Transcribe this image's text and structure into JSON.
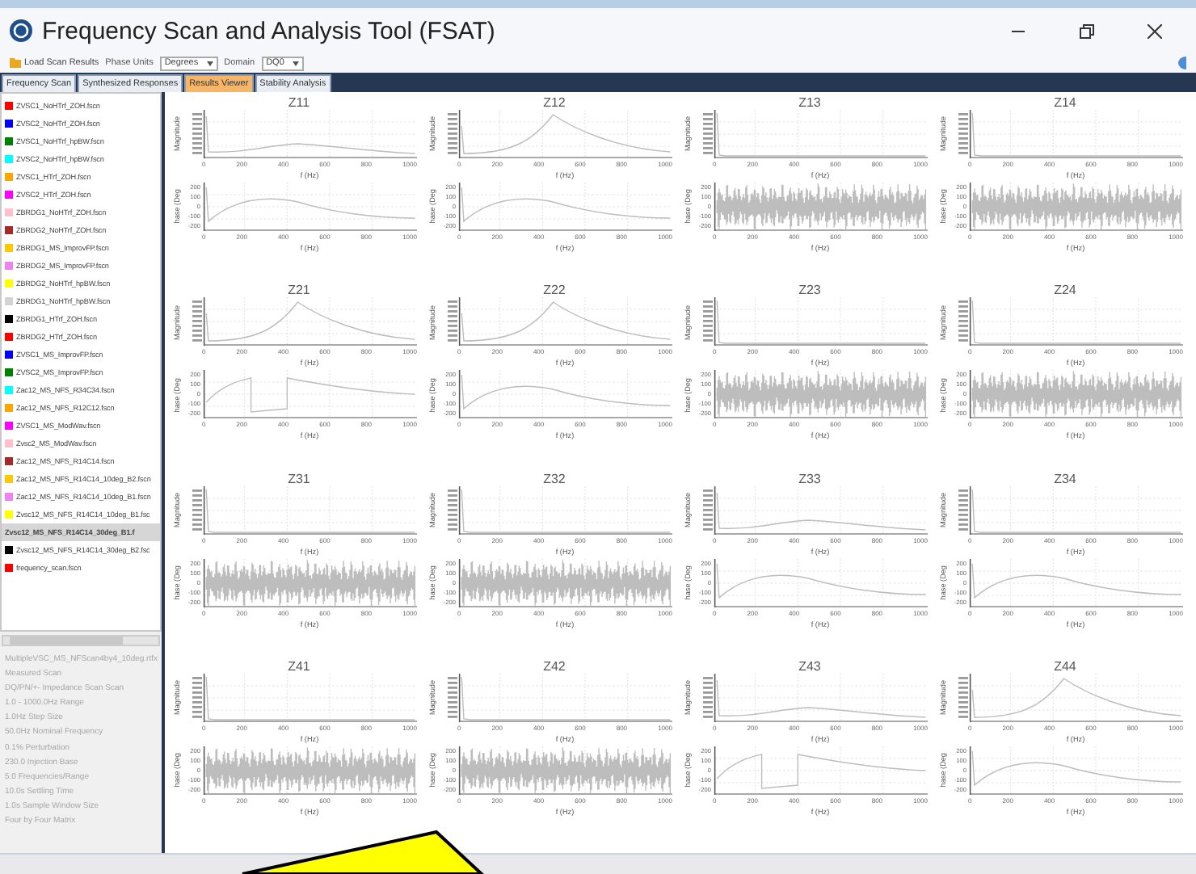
{
  "window": {
    "title": "Frequency Scan and Analysis Tool (FSAT)"
  },
  "toolbar": {
    "load_button": "Load Scan Results",
    "phase_units": {
      "label": "Phase Units",
      "value": "Degrees"
    },
    "domain": {
      "label": "Domain",
      "value": "DQ0"
    }
  },
  "tabs": [
    {
      "label": "Frequency Scan",
      "selected": false
    },
    {
      "label": "Synthesized Responses",
      "selected": false
    },
    {
      "label": "Results Viewer",
      "selected": true
    },
    {
      "label": "Stability Analysis",
      "selected": false
    }
  ],
  "scan_files": [
    {
      "name": "ZVSC1_NoHTrf_ZOH.fscn",
      "color": "#ff0000",
      "selected": false
    },
    {
      "name": "ZVSC2_NoHTrf_ZOH.fscn",
      "color": "#0000ff",
      "selected": false
    },
    {
      "name": "ZVSC1_NoHTrf_hpBW.fscn",
      "color": "#008000",
      "selected": false
    },
    {
      "name": "ZVSC2_NoHTrf_hpBW.fscn",
      "color": "#00ffff",
      "selected": false
    },
    {
      "name": "ZVSC1_HTrf_ZOH.fscn",
      "color": "#ffa500",
      "selected": false
    },
    {
      "name": "ZVSC2_HTrf_ZOH.fscn",
      "color": "#ff00ff",
      "selected": false
    },
    {
      "name": "ZBRDG1_NoHTrf_ZOH.fscn",
      "color": "#ffc0cb",
      "selected": false
    },
    {
      "name": "ZBRDG2_NoHTrf_ZOH.fscn",
      "color": "#a52a2a",
      "selected": false
    },
    {
      "name": "ZBRDG1_MS_ImprovFP.fscn",
      "color": "#ffc800",
      "selected": false
    },
    {
      "name": "ZBRDG2_MS_ImprovFP.fscn",
      "color": "#ee82ee",
      "selected": false
    },
    {
      "name": "ZBRDG2_NoHTrf_hpBW.fscn",
      "color": "#ffff00",
      "selected": false
    },
    {
      "name": "ZBRDG1_NoHTrf_hpBW.fscn",
      "color": "#d3d3d3",
      "selected": false
    },
    {
      "name": "ZBRDG1_HTrf_ZOH.fscn",
      "color": "#000000",
      "selected": false
    },
    {
      "name": "ZBRDG2_HTrf_ZOH.fscn",
      "color": "#ff0000",
      "selected": false
    },
    {
      "name": "ZVSC1_MS_ImprovFP.fscn",
      "color": "#0000ff",
      "selected": false
    },
    {
      "name": "ZVSC2_MS_ImprovFP.fscn",
      "color": "#008000",
      "selected": false
    },
    {
      "name": "Zac12_MS_NFS_R34C34.fscn",
      "color": "#00ffff",
      "selected": false
    },
    {
      "name": "Zac12_MS_NFS_R12C12.fscn",
      "color": "#ffa500",
      "selected": false
    },
    {
      "name": "ZVSC1_MS_ModWav.fscn",
      "color": "#ff00ff",
      "selected": false
    },
    {
      "name": "Zvsc2_MS_ModWav.fscn",
      "color": "#ffc0cb",
      "selected": false
    },
    {
      "name": "Zac12_MS_NFS_R14C14.fscn",
      "color": "#a52a2a",
      "selected": false
    },
    {
      "name": "Zac12_MS_NFS_R14C14_10deg_B2.fscn",
      "color": "#ffc800",
      "selected": false
    },
    {
      "name": "Zac12_MS_NFS_R14C14_10deg_B1.fscn",
      "color": "#ee82ee",
      "selected": false
    },
    {
      "name": "Zvsc12_MS_NFS_R14C14_10deg_B1.fsc",
      "color": "#ffff00",
      "selected": false
    },
    {
      "name": "Zvsc12_MS_NFS_R14C14_30deg_B1.f",
      "selected": true
    },
    {
      "name": "Zvsc12_MS_NFS_R14C14_30deg_B2.fsc",
      "color": "#000000",
      "selected": false
    },
    {
      "name": "frequency_scan.fscn",
      "color": "#ff0000",
      "selected": false
    }
  ],
  "scan_info": [
    "MultipleVSC_MS_NFScan4by4_10deg.rtfx",
    "Measured Scan",
    "DQ/PN/+- Impedance Scan Scan",
    "1.0 - 1000.0Hz Range",
    "1.0Hz Step Size",
    "50.0Hz Nominal Frequency",
    "0.1% Perturbation",
    "230.0 Injection Base",
    "5.0 Frequencies/Range",
    "10.0s Settling Time",
    "1.0s Sample Window Size",
    "Four by Four Matrix"
  ],
  "panels": [
    {
      "title": "Z11",
      "plots": [
        {
          "kind": "magnitude",
          "ylabel": "Magnitude",
          "xticks": [
            "0",
            "200",
            "400",
            "600",
            "800",
            "1000"
          ],
          "xlabel": "f (Hz)"
        },
        {
          "kind": "phase",
          "ylabel": "hase (Deg",
          "yticks": [
            "200",
            "100",
            "0",
            "-100",
            "-200"
          ],
          "xticks": [
            "0",
            "200",
            "400",
            "600",
            "800",
            "1000"
          ],
          "xlabel": "f (Hz)"
        }
      ]
    },
    {
      "title": "Z12",
      "plots": [
        {
          "kind": "magnitude",
          "ylabel": "Magnitude",
          "xticks": [
            "0",
            "200",
            "400",
            "600",
            "800",
            "1000"
          ],
          "xlabel": "f (Hz)"
        },
        {
          "kind": "phase",
          "ylabel": "hase (Deg",
          "yticks": [
            "200",
            "100",
            "0",
            "-100",
            "-200"
          ],
          "xticks": [
            "0",
            "200",
            "400",
            "600",
            "800",
            "1000"
          ],
          "xlabel": "f (Hz)"
        }
      ]
    },
    {
      "title": "Z13",
      "plots": [
        {
          "kind": "magnitude",
          "ylabel": "Magnitude",
          "xticks": [
            "0",
            "200",
            "400",
            "600",
            "800",
            "1000"
          ],
          "xlabel": "f (Hz)"
        },
        {
          "kind": "phase",
          "ylabel": "hase (Deg",
          "yticks": [
            "200",
            "100",
            "0",
            "-100",
            "-200"
          ],
          "xticks": [
            "0",
            "200",
            "400",
            "600",
            "800",
            "1000"
          ],
          "xlabel": "f (Hz)"
        }
      ]
    },
    {
      "title": "Z14",
      "plots": [
        {
          "kind": "magnitude",
          "ylabel": "Magnitude",
          "xticks": [
            "0",
            "200",
            "400",
            "600",
            "800",
            "1000"
          ],
          "xlabel": "f (Hz)"
        },
        {
          "kind": "phase",
          "ylabel": "hase (Deg",
          "yticks": [
            "200",
            "100",
            "0",
            "-100",
            "-200"
          ],
          "xticks": [
            "0",
            "200",
            "400",
            "600",
            "800",
            "1000"
          ],
          "xlabel": "f (Hz)"
        }
      ]
    },
    {
      "title": "Z21",
      "plots": [
        {
          "kind": "magnitude",
          "ylabel": "Magnitude",
          "xticks": [
            "0",
            "200",
            "400",
            "600",
            "800",
            "1000"
          ],
          "xlabel": "f (Hz)"
        },
        {
          "kind": "phase",
          "ylabel": "hase (Deg",
          "yticks": [
            "200",
            "100",
            "0",
            "-100",
            "-200"
          ],
          "xticks": [
            "0",
            "200",
            "400",
            "600",
            "800",
            "1000"
          ],
          "xlabel": "f (Hz)"
        }
      ]
    },
    {
      "title": "Z22",
      "plots": [
        {
          "kind": "magnitude",
          "ylabel": "Magnitude",
          "xticks": [
            "0",
            "200",
            "400",
            "600",
            "800",
            "1000"
          ],
          "xlabel": "f (Hz)"
        },
        {
          "kind": "phase",
          "ylabel": "hase (Deg",
          "yticks": [
            "200",
            "100",
            "0",
            "-100",
            "-200"
          ],
          "xticks": [
            "0",
            "200",
            "400",
            "600",
            "800",
            "1000"
          ],
          "xlabel": "f (Hz)"
        }
      ]
    },
    {
      "title": "Z23",
      "plots": [
        {
          "kind": "magnitude",
          "ylabel": "Magnitude",
          "xticks": [
            "0",
            "200",
            "400",
            "600",
            "800",
            "1000"
          ],
          "xlabel": "f (Hz)"
        },
        {
          "kind": "phase",
          "ylabel": "hase (Deg",
          "yticks": [
            "200",
            "100",
            "0",
            "-100",
            "-200"
          ],
          "xticks": [
            "0",
            "200",
            "400",
            "600",
            "800",
            "1000"
          ],
          "xlabel": "f (Hz)"
        }
      ]
    },
    {
      "title": "Z24",
      "plots": [
        {
          "kind": "magnitude",
          "ylabel": "Magnitude",
          "xticks": [
            "0",
            "200",
            "400",
            "600",
            "800",
            "1000"
          ],
          "xlabel": "f (Hz)"
        },
        {
          "kind": "phase",
          "ylabel": "hase (Deg",
          "yticks": [
            "200",
            "100",
            "0",
            "-100",
            "-200"
          ],
          "xticks": [
            "0",
            "200",
            "400",
            "600",
            "800",
            "1000"
          ],
          "xlabel": "f (Hz)"
        }
      ]
    },
    {
      "title": "Z31",
      "plots": [
        {
          "kind": "magnitude",
          "ylabel": "Magnitude",
          "xticks": [
            "0",
            "200",
            "400",
            "600",
            "800",
            "1000"
          ],
          "xlabel": "f (Hz)"
        },
        {
          "kind": "phase",
          "ylabel": "hase (Deg",
          "yticks": [
            "200",
            "100",
            "0",
            "-100",
            "-200"
          ],
          "xticks": [
            "0",
            "200",
            "400",
            "600",
            "800",
            "1000"
          ],
          "xlabel": "f (Hz)"
        }
      ]
    },
    {
      "title": "Z32",
      "plots": [
        {
          "kind": "magnitude",
          "ylabel": "Magnitude",
          "xticks": [
            "0",
            "200",
            "400",
            "600",
            "800",
            "1000"
          ],
          "xlabel": "f (Hz)"
        },
        {
          "kind": "phase",
          "ylabel": "hase (Deg",
          "yticks": [
            "200",
            "100",
            "0",
            "-100",
            "-200"
          ],
          "xticks": [
            "0",
            "200",
            "400",
            "600",
            "800",
            "1000"
          ],
          "xlabel": "f (Hz)"
        }
      ]
    },
    {
      "title": "Z33",
      "plots": [
        {
          "kind": "magnitude",
          "ylabel": "Magnitude",
          "xticks": [
            "0",
            "200",
            "400",
            "600",
            "800",
            "1000"
          ],
          "xlabel": "f (Hz)"
        },
        {
          "kind": "phase",
          "ylabel": "hase (Deg",
          "yticks": [
            "200",
            "100",
            "0",
            "-100",
            "-200"
          ],
          "xticks": [
            "0",
            "200",
            "400",
            "600",
            "800",
            "1000"
          ],
          "xlabel": "f (Hz)"
        }
      ]
    },
    {
      "title": "Z34",
      "plots": [
        {
          "kind": "magnitude",
          "ylabel": "Magnitude",
          "xticks": [
            "0",
            "200",
            "400",
            "600",
            "800",
            "1000"
          ],
          "xlabel": "f (Hz)"
        },
        {
          "kind": "phase",
          "ylabel": "hase (Deg",
          "yticks": [
            "200",
            "100",
            "0",
            "-100",
            "-200"
          ],
          "xticks": [
            "0",
            "200",
            "400",
            "600",
            "800",
            "1000"
          ],
          "xlabel": "f (Hz)"
        }
      ]
    },
    {
      "title": "Z41",
      "plots": [
        {
          "kind": "magnitude",
          "ylabel": "Magnitude",
          "xticks": [
            "0",
            "200",
            "400",
            "600",
            "800",
            "1000"
          ],
          "xlabel": "f (Hz)"
        },
        {
          "kind": "phase",
          "ylabel": "hase (Deg",
          "yticks": [
            "200",
            "100",
            "0",
            "-100",
            "-200"
          ],
          "xticks": [
            "0",
            "200",
            "400",
            "600",
            "800",
            "1000"
          ],
          "xlabel": "f (Hz)"
        }
      ]
    },
    {
      "title": "Z42",
      "plots": [
        {
          "kind": "magnitude",
          "ylabel": "Magnitude",
          "xticks": [
            "0",
            "200",
            "400",
            "600",
            "800",
            "1000"
          ],
          "xlabel": "f (Hz)"
        },
        {
          "kind": "phase",
          "ylabel": "hase (Deg",
          "yticks": [
            "200",
            "100",
            "0",
            "-100",
            "-200"
          ],
          "xticks": [
            "0",
            "200",
            "400",
            "600",
            "800",
            "1000"
          ],
          "xlabel": "f (Hz)"
        }
      ]
    },
    {
      "title": "Z43",
      "plots": [
        {
          "kind": "magnitude",
          "ylabel": "Magnitude",
          "xticks": [
            "0",
            "200",
            "400",
            "600",
            "800",
            "1000"
          ],
          "xlabel": "f (Hz)"
        },
        {
          "kind": "phase",
          "ylabel": "hase (Deg",
          "yticks": [
            "200",
            "100",
            "0",
            "-100",
            "-200"
          ],
          "xticks": [
            "0",
            "200",
            "400",
            "600",
            "800",
            "1000"
          ],
          "xlabel": "f (Hz)"
        }
      ]
    },
    {
      "title": "Z44",
      "plots": [
        {
          "kind": "magnitude",
          "ylabel": "Magnitude",
          "xticks": [
            "0",
            "200",
            "400",
            "600",
            "800",
            "1000"
          ],
          "xlabel": "f (Hz)"
        },
        {
          "kind": "phase",
          "ylabel": "hase (Deg",
          "yticks": [
            "200",
            "100",
            "0",
            "-100",
            "-200"
          ],
          "xticks": [
            "0",
            "200",
            "400",
            "600",
            "800",
            "1000"
          ],
          "xlabel": "f (Hz)"
        }
      ]
    }
  ]
}
